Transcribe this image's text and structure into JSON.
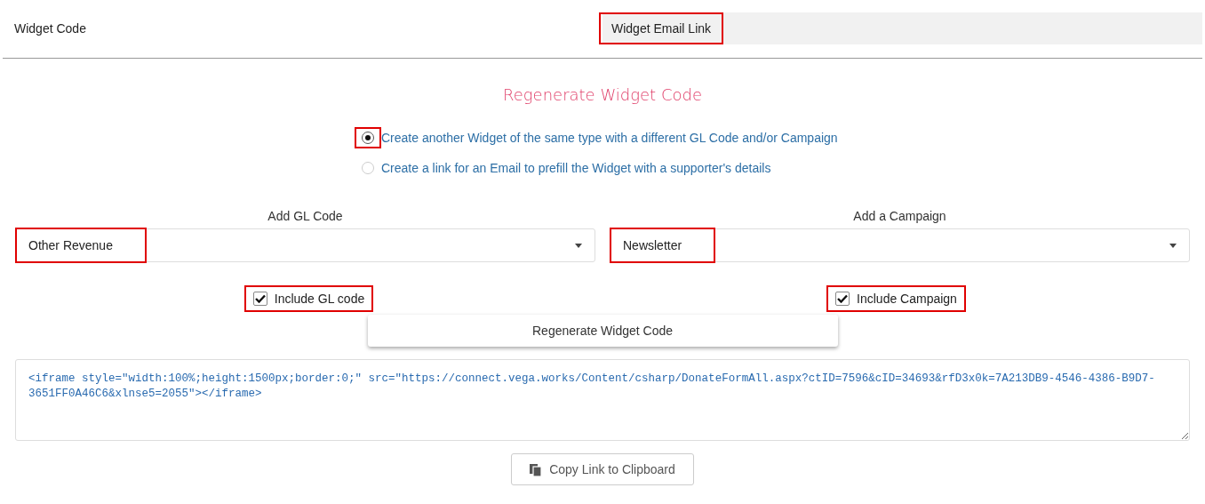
{
  "tabs": [
    {
      "label": "Widget Code",
      "selected": true,
      "highlighted": false
    },
    {
      "label": "Widget Email Link",
      "selected": false,
      "highlighted": true
    }
  ],
  "heading": "Regenerate Widget Code",
  "options": [
    {
      "label": "Create another Widget of the same type with a different GL Code and/or Campaign",
      "selected": true,
      "highlighted": true
    },
    {
      "label": "Create a link for an Email to prefill the Widget with a supporter's details",
      "selected": false,
      "highlighted": false
    }
  ],
  "selects": [
    {
      "label": "Add GL Code",
      "value": "Other Revenue",
      "highlighted": true
    },
    {
      "label": "Add a Campaign",
      "value": "Newsletter",
      "highlighted": true
    }
  ],
  "checkboxes": [
    {
      "label": "Include GL code",
      "checked": true,
      "highlighted": true
    },
    {
      "label": "Include Campaign",
      "checked": true,
      "highlighted": true
    }
  ],
  "regenerate_button": "Regenerate Widget Code",
  "code": "<iframe style=\"width:100%;height:1500px;border:0;\" src=\"https://connect.vega.works/Content/csharp/DonateFormAll.aspx?ctID=7596&cID=34693&rfD3x0k=7A213DB9-4546-4386-B9D7-3651FF0A46C6&xlnse5=2055\"></iframe>",
  "copy_button": "Copy Link to Clipboard"
}
